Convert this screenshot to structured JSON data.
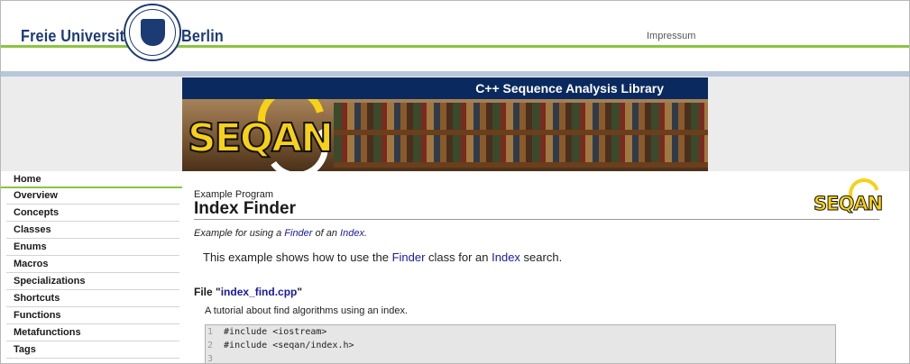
{
  "header": {
    "left_name": "Freie Universität",
    "right_name": "Berlin",
    "impressum": "Impressum",
    "colors": {
      "green": "#8bc43f",
      "navy": "#1c3a73",
      "band": "#b8c6db"
    }
  },
  "banner": {
    "title": "C++ Sequence Analysis Library",
    "logo_text": "SEQAN"
  },
  "sidebar": {
    "items": [
      "Home",
      "Overview",
      "Concepts",
      "Classes",
      "Enums",
      "Macros",
      "Specializations",
      "Shortcuts",
      "Functions",
      "Metafunctions",
      "Tags"
    ]
  },
  "main": {
    "program_label": "Example Program",
    "title": "Index Finder",
    "corner_logo": "SEQAN",
    "summary": {
      "before": "Example for using a ",
      "link1": "Finder",
      "middle": " of an ",
      "link2": "Index",
      "after": "."
    },
    "intro": {
      "before": "This example shows how to use the ",
      "link1": "Finder",
      "middle": " class for an ",
      "link2": "Index",
      "after": " search."
    },
    "file": {
      "prefix": "File \"",
      "name": "index_find.cpp",
      "suffix": "\""
    },
    "file_description": "A tutorial about find algorithms using an index.",
    "code_lines": [
      {
        "num": "1",
        "text": "#include <iostream>"
      },
      {
        "num": "2",
        "text": "#include <seqan/index.h>"
      },
      {
        "num": "3",
        "text": ""
      }
    ]
  }
}
